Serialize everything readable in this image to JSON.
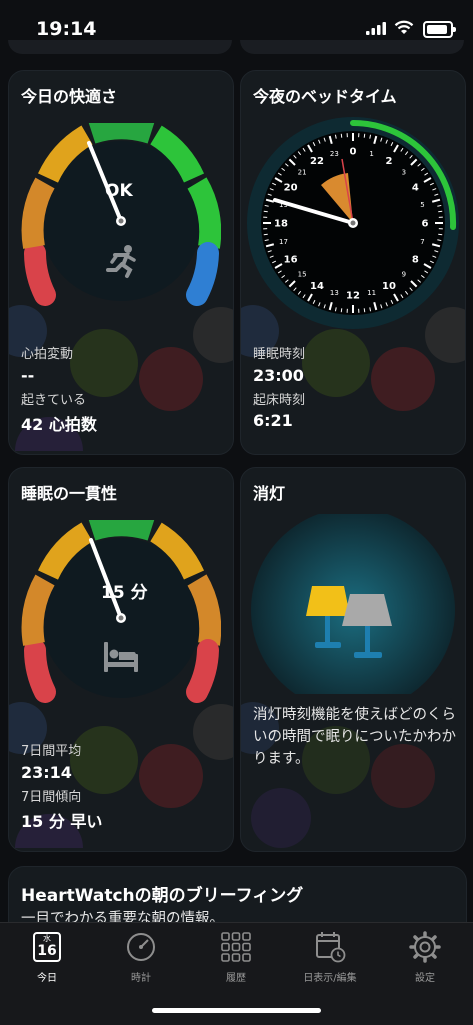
{
  "status": {
    "time": "19:14"
  },
  "comfort": {
    "title": "今日の快適さ",
    "gauge_text": "OK",
    "label1": "心拍変動",
    "value1": "--",
    "label2": "起きている",
    "value2": "42 心拍数",
    "icon": "running-person-icon"
  },
  "bedtime": {
    "title": "今夜のベッドタイム",
    "hour_labels": [
      "0",
      "2",
      "4",
      "6",
      "8",
      "10",
      "12",
      "14",
      "16",
      "18",
      "20",
      "22"
    ],
    "minor_labels": [
      "1",
      "3",
      "5",
      "7",
      "9",
      "11",
      "13",
      "15",
      "17",
      "19",
      "21",
      "23"
    ],
    "label1": "睡眠時刻",
    "value1": "23:00",
    "label2": "起床時刻",
    "value2": "6:21"
  },
  "consistency": {
    "title": "睡眠の一貫性",
    "gauge_text": "15 分",
    "label1": "7日間平均",
    "value1": "23:14",
    "label2": "7日間傾向",
    "value2": "15 分 早い",
    "icon": "bed-icon"
  },
  "lights_out": {
    "title": "消灯",
    "message": "消灯時刻機能を使えばどのくらいの時間で眠りについたかわかります。",
    "icon": "lamp-icon"
  },
  "briefing": {
    "title": "HeartWatchの朝のブリーフィング",
    "subtitle": "一目でわかる重要な朝の情報。"
  },
  "tabs": [
    {
      "label": "今日",
      "icon": "calendar-today-icon",
      "badge_day": "水",
      "badge_date": "16"
    },
    {
      "label": "時計",
      "icon": "clock-icon"
    },
    {
      "label": "履歴",
      "icon": "grid-icon"
    },
    {
      "label": "日表示/編集",
      "icon": "calendar-edit-icon"
    },
    {
      "label": "設定",
      "icon": "gear-icon"
    }
  ],
  "colors": {
    "red": "#d9434a",
    "orange": "#d3882a",
    "yellow": "#e0a31c",
    "green": "#27a640",
    "lime": "#2dc43a",
    "blue": "#2f7fd3"
  }
}
